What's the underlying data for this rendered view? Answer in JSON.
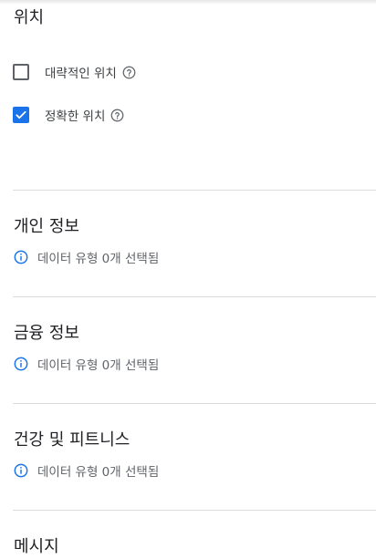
{
  "location": {
    "title": "위치",
    "approximate": {
      "label": "대략적인 위치",
      "checked": false,
      "icon": "help-icon"
    },
    "precise": {
      "label": "정확한 위치",
      "checked": true,
      "icon": "help-icon"
    }
  },
  "sections": [
    {
      "title": "개인 정보",
      "info": "데이터 유형 0개 선택됨"
    },
    {
      "title": "금융 정보",
      "info": "데이터 유형 0개 선택됨"
    },
    {
      "title": "건강 및 피트니스",
      "info": "데이터 유형 0개 선택됨"
    },
    {
      "title": "메시지"
    }
  ],
  "colors": {
    "accent": "#1a73e8",
    "info_icon": "#1a73e8",
    "divider": "#dadce0"
  }
}
